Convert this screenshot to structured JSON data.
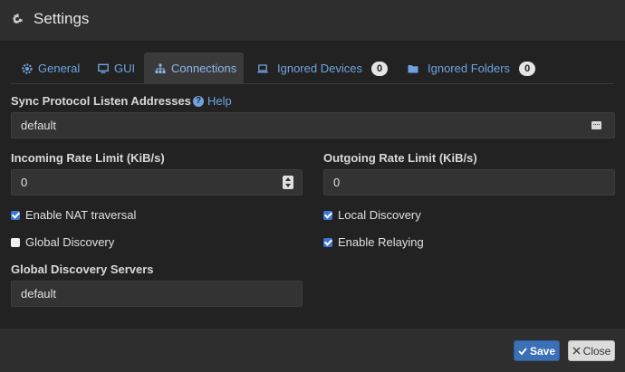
{
  "dialog": {
    "title": "Settings"
  },
  "tabs": [
    {
      "label": "General",
      "icon": "gear-icon"
    },
    {
      "label": "GUI",
      "icon": "monitor-icon"
    },
    {
      "label": "Connections",
      "icon": "sitemap-icon",
      "active": true
    },
    {
      "label": "Ignored Devices",
      "icon": "laptop-icon",
      "badge": "0"
    },
    {
      "label": "Ignored Folders",
      "icon": "folder-icon",
      "badge": "0"
    }
  ],
  "sync": {
    "label": "Sync Protocol Listen Addresses",
    "help": "Help",
    "value": "default"
  },
  "incoming": {
    "label": "Incoming Rate Limit (KiB/s)",
    "value": "0"
  },
  "outgoing": {
    "label": "Outgoing Rate Limit (KiB/s)",
    "value": "0"
  },
  "checks": {
    "nat": {
      "label": "Enable NAT traversal",
      "checked": true
    },
    "global": {
      "label": "Global Discovery",
      "checked": false
    },
    "local": {
      "label": "Local Discovery",
      "checked": true
    },
    "relay": {
      "label": "Enable Relaying",
      "checked": true
    }
  },
  "servers": {
    "label": "Global Discovery Servers",
    "value": "default"
  },
  "footer": {
    "save": "Save",
    "close": "Close"
  }
}
